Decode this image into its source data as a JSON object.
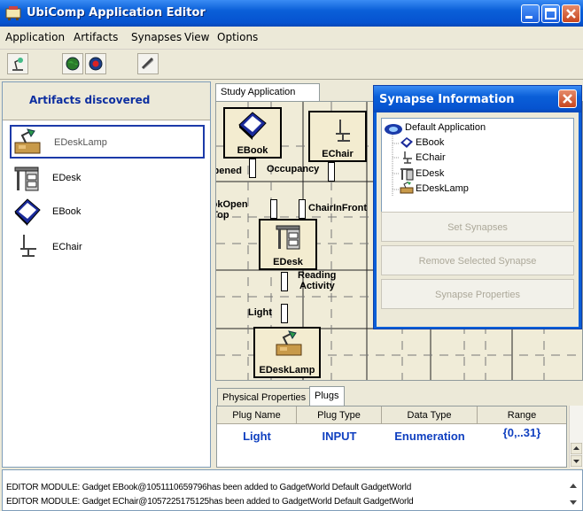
{
  "window": {
    "title": "UbiComp Application Editor"
  },
  "menu": [
    "Application",
    "Artifacts",
    "Synapses",
    "View",
    "Options"
  ],
  "left_panel": {
    "title": "Artifacts discovered",
    "items": [
      {
        "label": "EDeskLamp",
        "icon": "desk-lamp-icon",
        "selected": true
      },
      {
        "label": "EDesk",
        "icon": "desk-icon",
        "selected": false
      },
      {
        "label": "EBook",
        "icon": "book-icon",
        "selected": false
      },
      {
        "label": "EChair",
        "icon": "chair-icon",
        "selected": false
      }
    ]
  },
  "diagram": {
    "tab": "Study Application",
    "nodes": {
      "ebook": "EBook",
      "echair": "EChair",
      "edesk": "EDesk",
      "edesklamp": "EDeskLamp"
    },
    "plugs": {
      "opened": "Opened",
      "occupancy": "Occupancy",
      "bookopen": "BookOpen",
      "ontop": "OnTop",
      "chairinfront": "ChairInFront",
      "reading": "Reading",
      "activity": "Activity",
      "light": "Light"
    }
  },
  "synapse_window": {
    "title": "Synapse Information",
    "tree_root": "Default Application",
    "tree_items": [
      "EBook",
      "EChair",
      "EDesk",
      "EDeskLamp"
    ],
    "buttons": {
      "set": "Set Synapses",
      "remove": "Remove Selected Synapse",
      "props": "Synapse Properties"
    }
  },
  "properties": {
    "tabs": [
      "Physical Properties",
      "Plugs"
    ],
    "active_tab": "Plugs",
    "columns": [
      "Plug Name",
      "Plug Type",
      "Data Type",
      "Range"
    ],
    "row": {
      "name": "Light",
      "type": "INPUT",
      "data_type": "Enumeration",
      "range": "{0,..31}"
    }
  },
  "console": [
    "EDITOR MODULE: Gadget EBook@1051110659796has been added to GadgetWorld Default GadgetWorld",
    "EDITOR MODULE: Gadget EChair@1057225175125has been added to GadgetWorld Default GadgetWorld"
  ],
  "colors": {
    "title_blue": "#0a5fd8",
    "accent_text": "#1040c0"
  }
}
